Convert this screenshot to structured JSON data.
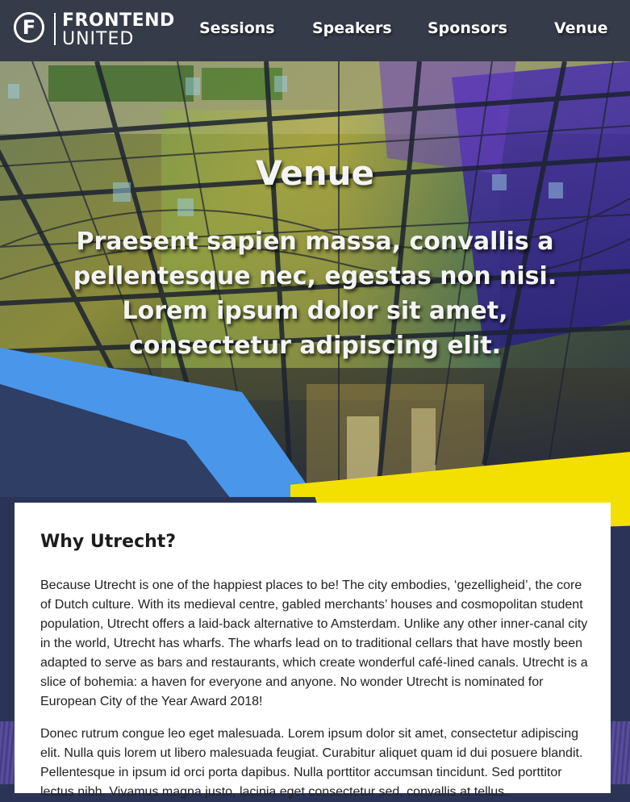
{
  "nav": {
    "logo_letter": "F",
    "logo_line1": "FRONTEND",
    "logo_line2": "UNITED",
    "links": [
      "Sessions",
      "Speakers",
      "Sponsors",
      "Venue"
    ]
  },
  "hero": {
    "title": "Venue",
    "subtitle": "Praesent sapien massa, convallis a pellentesque nec, egestas non nisi. Lorem ipsum dolor sit amet, consectetur adipiscing elit."
  },
  "content": {
    "heading": "Why Utrecht?",
    "paragraphs": [
      "Because Utrecht is one of the happiest places to be! The city embodies, ‘gezelligheid’, the core of Dutch culture. With its medieval centre, gabled merchants’ houses and cosmopolitan student population, Utrecht offers a laid-back alternative to Amsterdam. Unlike any other inner-canal city in the world, Utrecht has wharfs. The wharfs lead on to traditional cellars that have mostly been adapted to serve as bars and restaurants, which create wonderful café-lined canals. Utrecht is a slice of bohemia: a haven for everyone and anyone. No wonder Utrecht is nominated for European City of the Year Award 2018!",
      "Donec rutrum congue leo eget malesuada. Lorem ipsum dolor sit amet, consectetur adipiscing elit. Nulla quis lorem ut libero malesuada feugiat. Curabitur aliquet quam id dui posuere blandit. Pellentesque in ipsum id orci porta dapibus. Nulla porttitor accumsan tincidunt. Sed porttitor lectus nibh. Vivamus magna justo, lacinia eget consectetur sed, convallis at tellus."
    ]
  },
  "colors": {
    "nav_bg": "#363b4a",
    "accent_blue": "#4a96ea",
    "accent_yellow": "#f4e000",
    "accent_navy": "#2b3457"
  }
}
